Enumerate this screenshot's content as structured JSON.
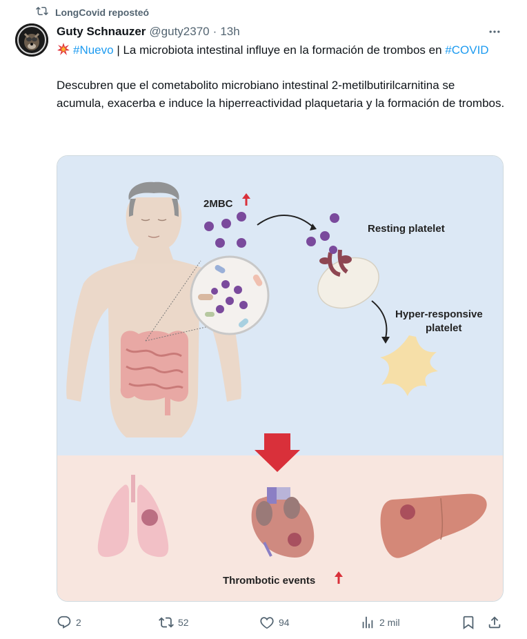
{
  "repost": {
    "label": "LongCovid reposteó",
    "icon": "repost-icon"
  },
  "tweet": {
    "author": {
      "display_name": "Guty Schnauzer",
      "handle": "@guty2370",
      "separator": "·",
      "time": "13h"
    },
    "text": {
      "emoji": "collision-icon",
      "hashtag_nuevo": "#Nuevo",
      "line1_rest": " | La microbiota intestinal influye en la formación de trombos en ",
      "hashtag_covid": "#COVID",
      "paragraph2": "Descubren que el cometabolito microbiano intestinal 2-metilbutirilcarnitina se acumula, exacerba e induce la hiperreactividad plaquetaria y la formación de trombos."
    },
    "figure": {
      "label_2mbc": "2MBC",
      "label_resting": "Resting platelet",
      "label_hyper_1": "Hyper-responsive",
      "label_hyper_2": "platelet",
      "label_thrombotic": "Thrombotic events",
      "colors": {
        "top_bg": "#dce8f5",
        "bottom_bg": "#f8e6df",
        "arrow_red": "#d9303a",
        "molecule": "#7a4a9c"
      }
    },
    "actions": {
      "reply_count": "2",
      "repost_count": "52",
      "like_count": "94",
      "views_count": "2 mil"
    }
  }
}
